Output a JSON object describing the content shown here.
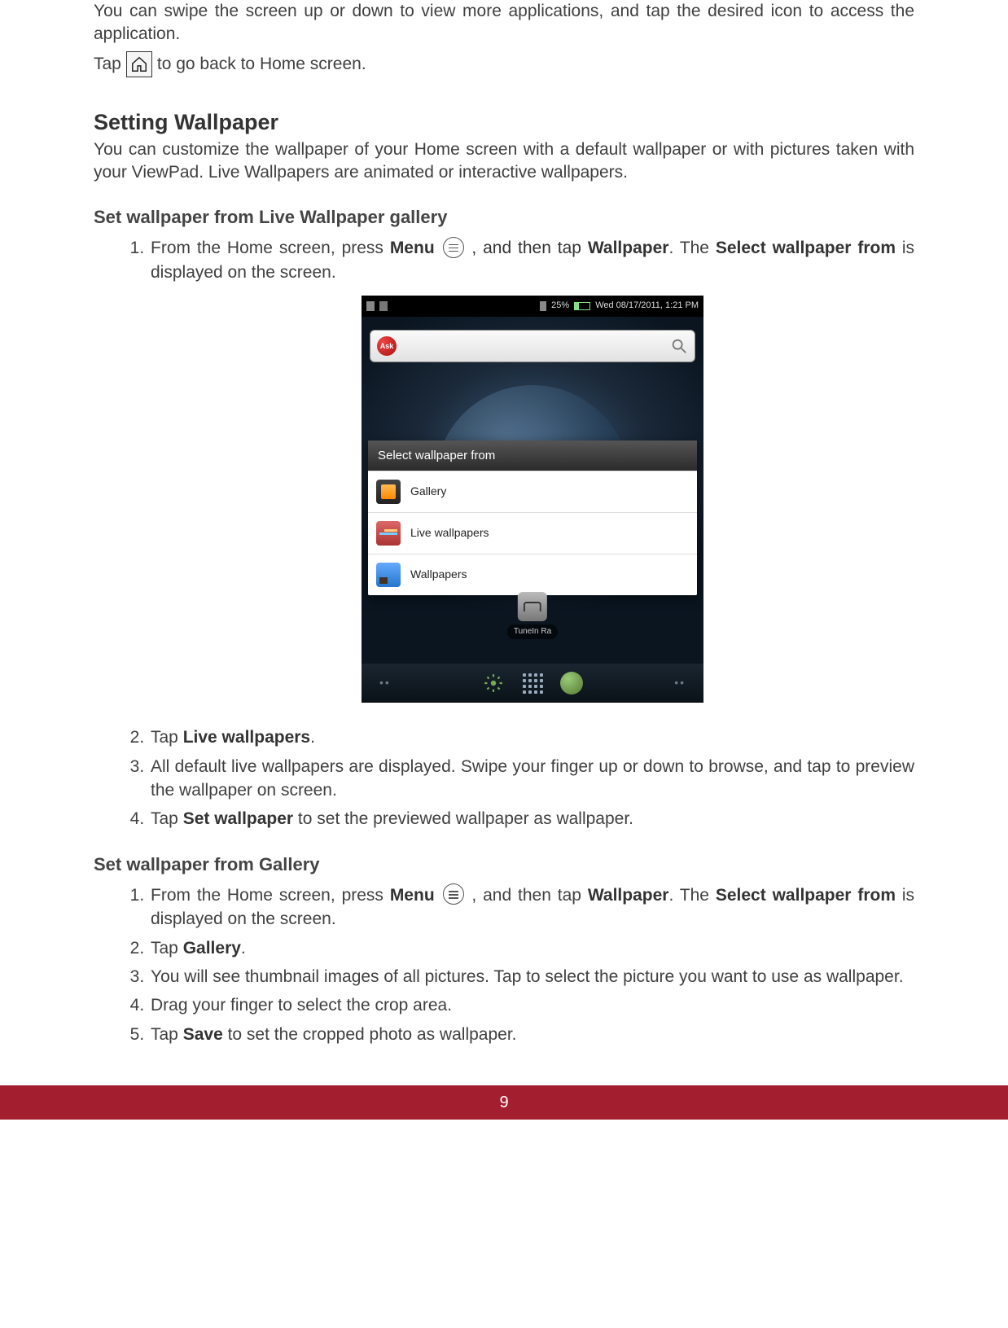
{
  "intro": {
    "swipe_text": "You can swipe the screen up or down to view more applications, and tap the desired icon to access the application.",
    "tap_prefix": "Tap",
    "tap_suffix": "to go back to Home screen."
  },
  "section": {
    "title": "Setting Wallpaper",
    "desc": "You can customize the wallpaper of your Home screen with a default wallpaper or with pictures taken with your ViewPad. Live Wallpapers are animated or interactive wallpapers."
  },
  "sub1": {
    "title": "Set wallpaper from Live Wallpaper gallery",
    "step1": {
      "pre": "From the Home screen, press ",
      "menu": "Menu",
      "mid": " , and then tap ",
      "wallpaper": "Wallpaper",
      "after": ". The ",
      "select": "Select wallpaper from",
      "tail": " is displayed on the screen."
    },
    "step2": {
      "pre": "Tap ",
      "bold": "Live wallpapers",
      "post": "."
    },
    "step3": "All default live wallpapers are displayed. Swipe your finger up or down to browse, and tap to preview the wallpaper on screen.",
    "step4": {
      "pre": "Tap ",
      "bold": "Set wallpaper",
      "post": " to set the previewed wallpaper as wallpaper."
    }
  },
  "sub2": {
    "title": "Set wallpaper from Gallery",
    "step1": {
      "pre": "From the Home screen, press ",
      "menu": "Menu",
      "mid": " , and then tap ",
      "wallpaper": "Wallpaper",
      "after": ". The ",
      "select": "Select wallpaper from",
      "tail": " is displayed on the screen."
    },
    "step2": {
      "pre": "Tap ",
      "bold": "Gallery",
      "post": "."
    },
    "step3": "You will see thumbnail images of all pictures. Tap to select the picture you want to use as wallpaper.",
    "step4": "Drag your finger to select the crop area.",
    "step5": {
      "pre": "Tap ",
      "bold": "Save",
      "post": " to set the cropped photo as wallpaper."
    }
  },
  "screenshot": {
    "statusbar": {
      "battery": "25%",
      "datetime": "Wed 08/17/2011, 1:21 PM"
    },
    "search_provider": "Ask",
    "dialog_title": "Select wallpaper from",
    "dialog_items": [
      "Gallery",
      "Live wallpapers",
      "Wallpapers"
    ],
    "app_label": "TuneIn Ra"
  },
  "page_number": "9"
}
